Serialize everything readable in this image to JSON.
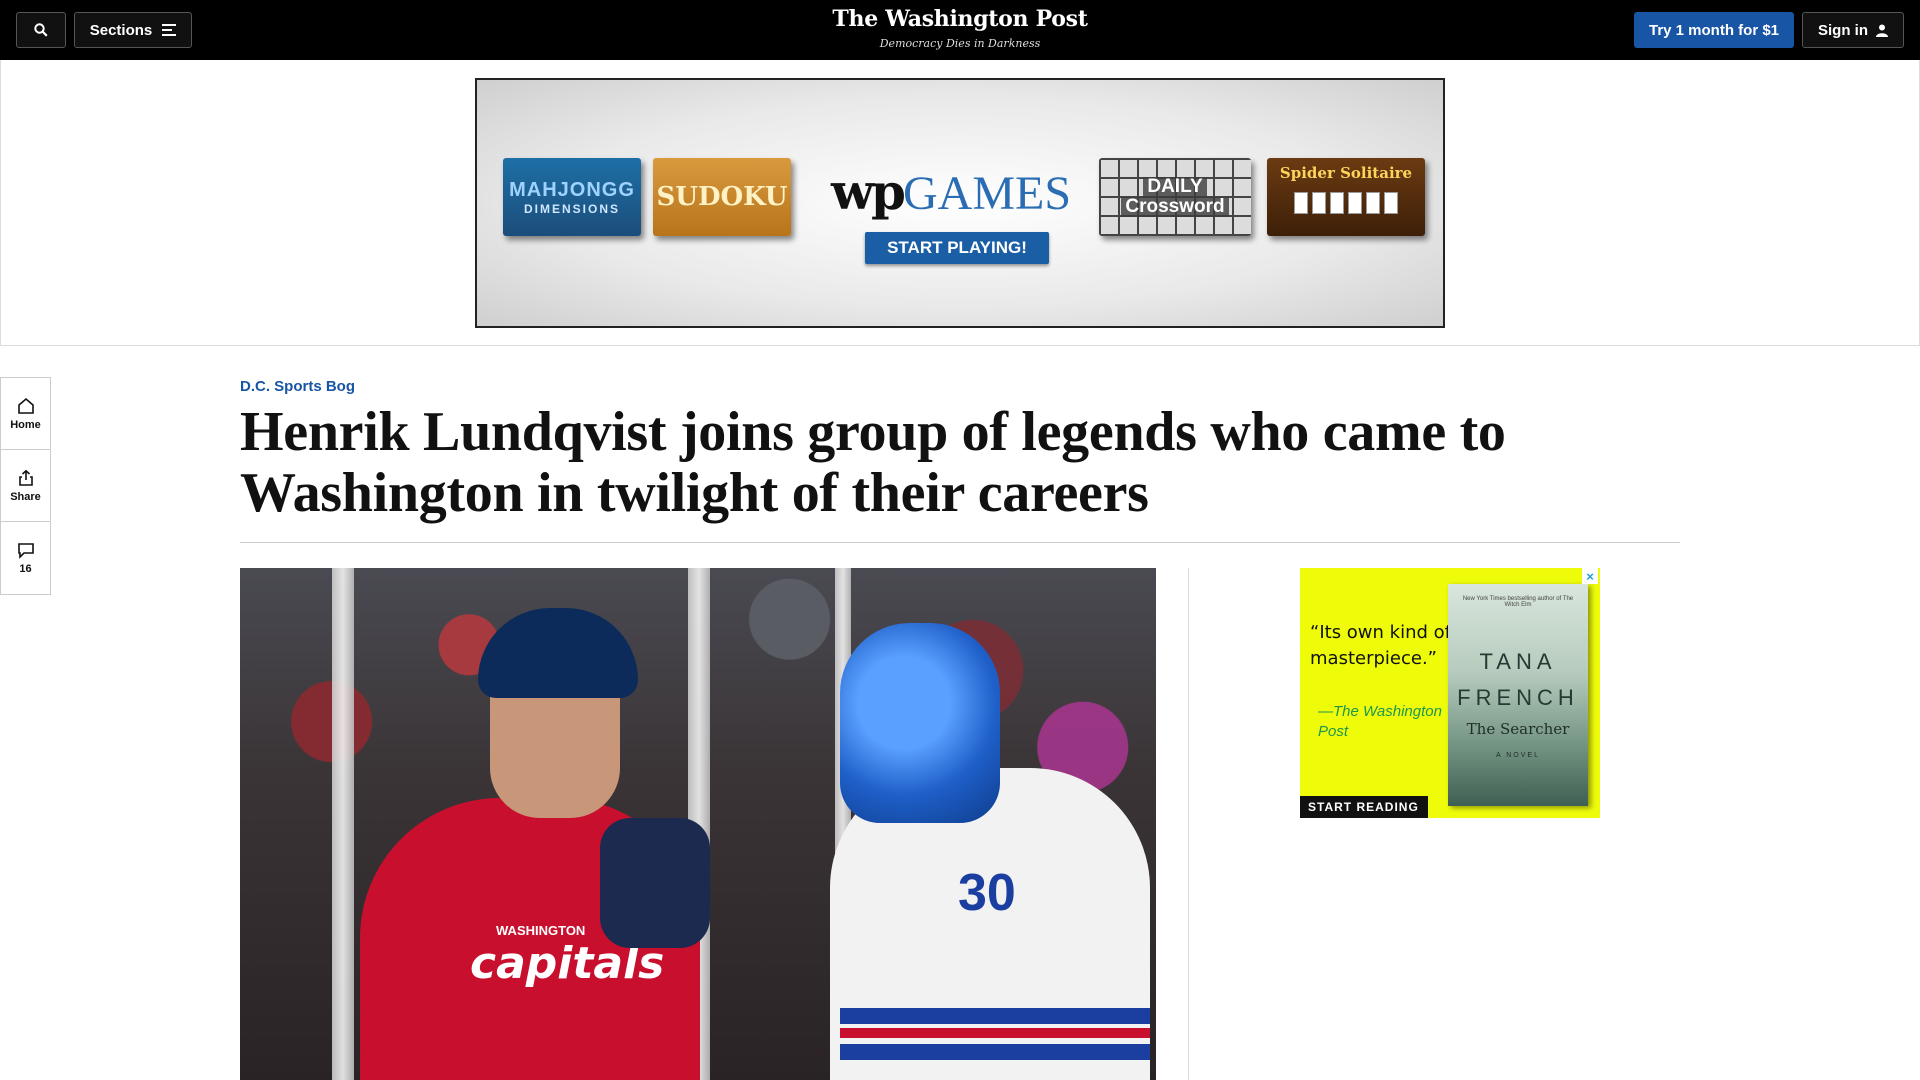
{
  "topbar": {
    "sections_label": "Sections",
    "logo": "The Washington Post",
    "tagline": "Democracy Dies in Darkness",
    "try_label": "Try 1 month for $1",
    "signin_label": "Sign in"
  },
  "games_ad": {
    "tiles": {
      "mahjong_line1": "MAHJONGG",
      "mahjong_line2": "DIMENSIONS",
      "sudoku": "SUDOKU",
      "crossword_line1": "DAILY",
      "crossword_line2": "Crossword",
      "solitaire": "Spider Solitaire"
    },
    "brand_wp": "wp",
    "brand_games": "GAMES",
    "cta": "START PLAYING!"
  },
  "rail": {
    "home": "Home",
    "share": "Share",
    "comments_count": "16"
  },
  "article": {
    "kicker": "D.C. Sports Bog",
    "headline": "Henrik Lundqvist joins group of legends who came to Washington in twilight of their careers"
  },
  "photo": {
    "jersey_small": "WASHINGTON",
    "jersey_logo": "capitals",
    "goalie_number": "30"
  },
  "book_ad": {
    "quote": "“Its own kind of masterpiece.”",
    "source": "—The Washington Post",
    "book_blurb": "New York Times bestselling author of The Witch Elm",
    "author": "TANA FRENCH",
    "title": "The Searcher",
    "novel": "A NOVEL",
    "cta": "START READING"
  },
  "colors": {
    "accent_blue": "#1955a5",
    "topbar_bg": "#000000",
    "book_ad_bg": "#eefc0a"
  }
}
